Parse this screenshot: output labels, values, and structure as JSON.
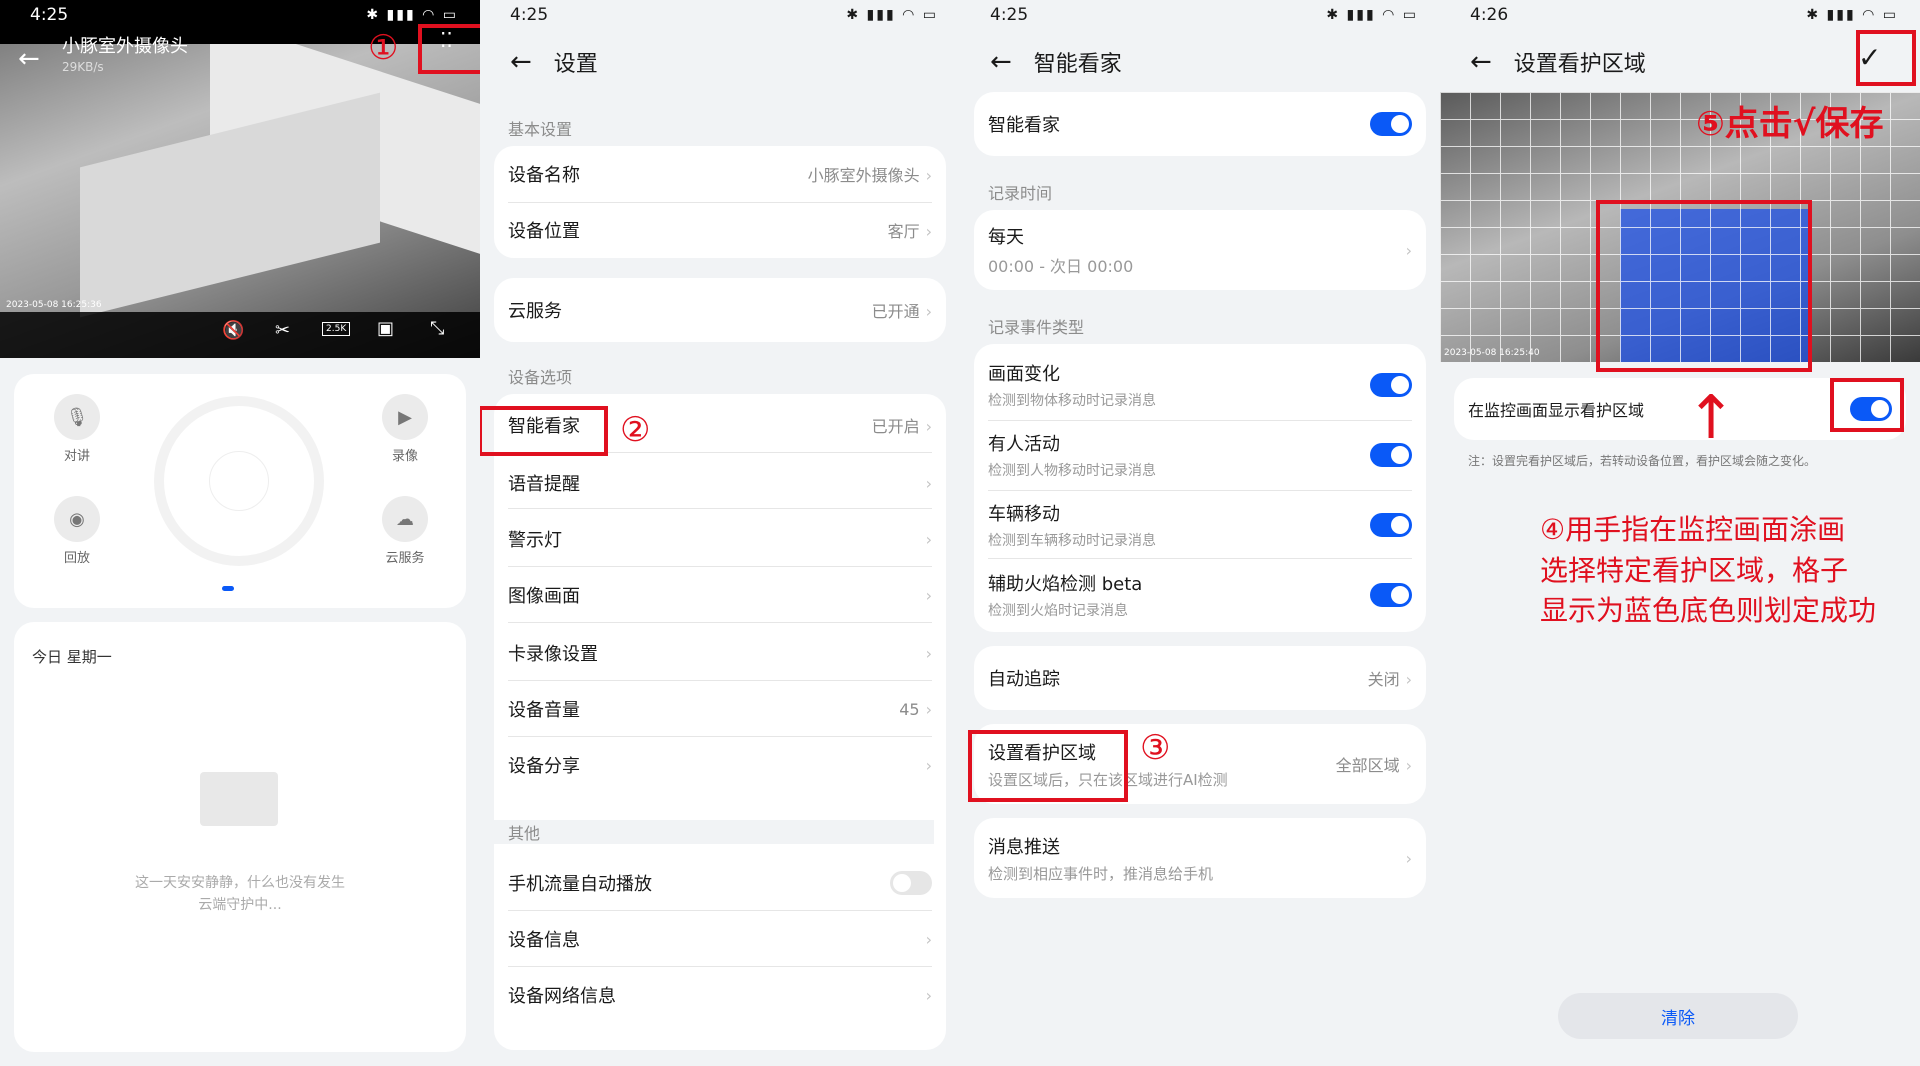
{
  "time": {
    "p1": "4:25",
    "p2": "4:25",
    "p3": "4:25",
    "p4": "4:26"
  },
  "status_icons": "✱ ▮▮▮ ◠ ▭",
  "panel1": {
    "camera_name": "小豚室外摄像头",
    "bitrate": "29KB/s",
    "timestamp": "2023-05-08  16:25:36",
    "quality_badge": "2.5K",
    "controls": {
      "talk": "对讲",
      "record": "录像",
      "playback": "回放",
      "cloud": "云服务"
    },
    "today_label": "今日 星期一",
    "empty_line1": "这一天安安静静，什么也没有发生",
    "empty_line2": "云端守护中..."
  },
  "panel2": {
    "title": "设置",
    "section_basic": "基本设置",
    "device_name": {
      "label": "设备名称",
      "value": "小豚室外摄像头"
    },
    "device_location": {
      "label": "设备位置",
      "value": "客厅"
    },
    "cloud_service": {
      "label": "云服务",
      "value": "已开通"
    },
    "section_options": "设备选项",
    "smart_care": {
      "label": "智能看家",
      "value": "已开启"
    },
    "voice_reminder": "语音提醒",
    "warning_light": "警示灯",
    "image_picture": "图像画面",
    "card_record": "卡录像设置",
    "device_volume": {
      "label": "设备音量",
      "value": "45"
    },
    "device_share": "设备分享",
    "section_other": "其他",
    "mobile_autoplay": "手机流量自动播放",
    "device_info": "设备信息",
    "device_network": "设备网络信息"
  },
  "panel3": {
    "title": "智能看家",
    "smart_care_label": "智能看家",
    "section_record_time": "记录时间",
    "every_day": "每天",
    "every_day_range": "00:00 - 次日 00:00",
    "section_event_types": "记录事件类型",
    "events": [
      {
        "label": "画面变化",
        "desc": "检测到物体移动时记录消息"
      },
      {
        "label": "有人活动",
        "desc": "检测到人物移动时记录消息"
      },
      {
        "label": "车辆移动",
        "desc": "检测到车辆移动时记录消息"
      },
      {
        "label": "辅助火焰检测 beta",
        "desc": "检测到火焰时记录消息"
      }
    ],
    "auto_track": {
      "label": "自动追踪",
      "value": "关闭"
    },
    "guard_area": {
      "label": "设置看护区域",
      "desc": "设置区域后，只在该区域进行AI检测",
      "value": "全部区域"
    },
    "push": {
      "label": "消息推送",
      "desc": "检测到相应事件时，推消息给手机"
    }
  },
  "panel4": {
    "title": "设置看护区域",
    "timestamp": "2023-05-08  16:25:40",
    "show_area_label": "在监控画面显示看护区域",
    "note": "注：设置完看护区域后，若转动设备位置，看护区域会随之变化。",
    "clear": "清除"
  },
  "annotations": {
    "n1": "①",
    "n2": "②",
    "n3": "③",
    "n5": "⑤点击√保存",
    "n4_line1": "④用手指在监控画面涂画",
    "n4_line2": "选择特定看护区域，格子",
    "n4_line3": "显示为蓝色底色则划定成功"
  },
  "colors": {
    "accent": "#0a59f7",
    "annotation_red": "#e0101f"
  }
}
